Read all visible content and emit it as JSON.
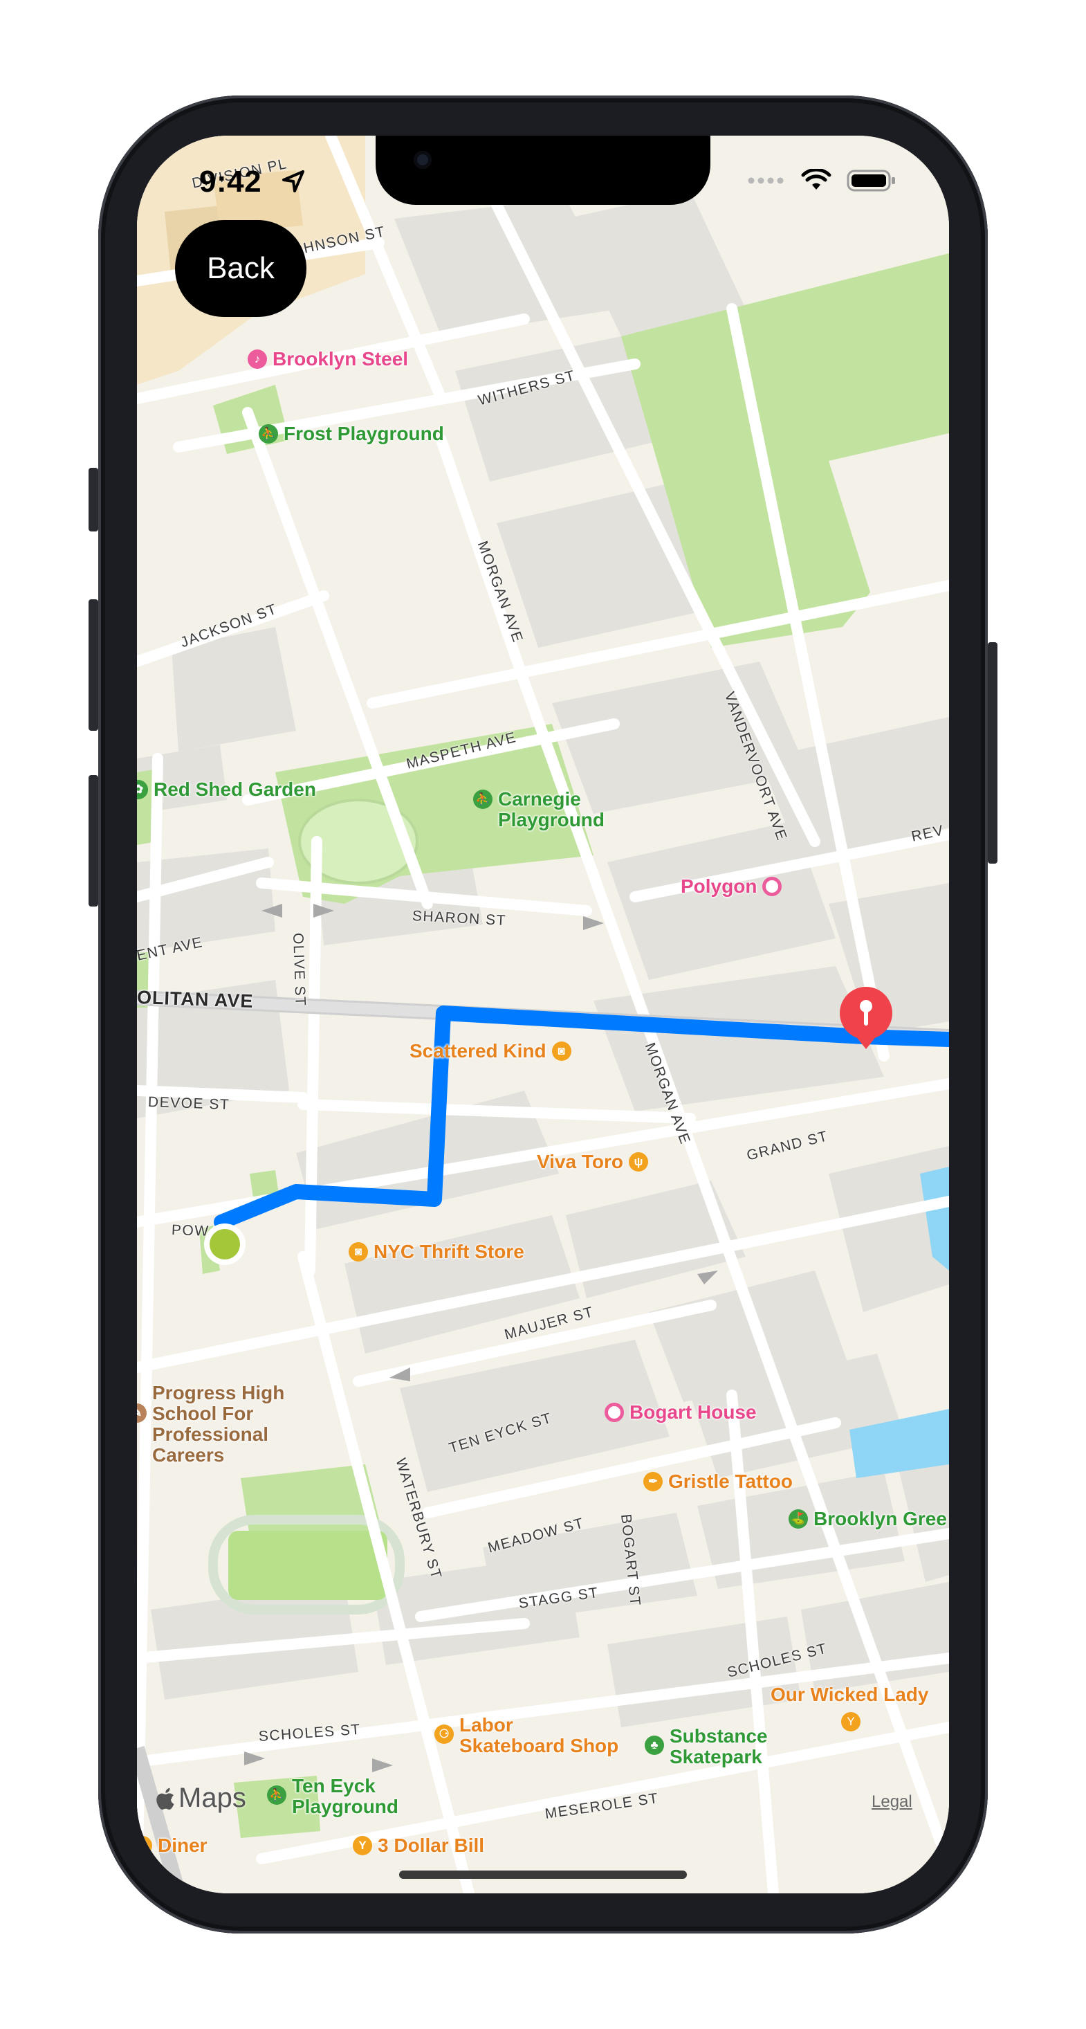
{
  "status_bar": {
    "time": "9:42"
  },
  "back_button": {
    "label": "Back"
  },
  "map": {
    "attribution": "Maps",
    "legal": "Legal",
    "route_color": "#007aff",
    "origin_color": "#a4c639",
    "destination_color": "#f0424a",
    "park_color": "#c2e39f",
    "water_color": "#8fd5f5",
    "pois": [
      {
        "label": "Brooklyn Steel",
        "category": "music-icon",
        "color": "pink"
      },
      {
        "label": "Frost Playground",
        "category": "playground-icon",
        "color": "green"
      },
      {
        "label": "Red Shed Garden",
        "category": "park-icon",
        "color": "green"
      },
      {
        "label": "Carnegie\nPlayground",
        "category": "playground-icon",
        "color": "green"
      },
      {
        "label": "Polygon",
        "category": "point-icon",
        "color": "pink"
      },
      {
        "label": "Scattered Kind",
        "category": "shopping-bag-icon",
        "color": "orange"
      },
      {
        "label": "Viva Toro",
        "category": "restaurant-icon",
        "color": "orange"
      },
      {
        "label": "NYC Thrift Store",
        "category": "shopping-bag-icon",
        "color": "orange"
      },
      {
        "label": "Progress High\nSchool For\nProfessional\nCareers",
        "category": "school-icon",
        "color": "brown"
      },
      {
        "label": "Bogart House",
        "category": "point-icon",
        "color": "pink"
      },
      {
        "label": "Gristle Tattoo",
        "category": "tattoo-icon",
        "color": "orange"
      },
      {
        "label": "Brooklyn Gree",
        "category": "park-icon",
        "color": "green"
      },
      {
        "label": "Our Wicked Lady",
        "category": "bar-icon",
        "color": "orange"
      },
      {
        "label": "Labor\nSkateboard Shop",
        "category": "skateboard-icon",
        "color": "orange"
      },
      {
        "label": "Substance\nSkatepark",
        "category": "tree-icon",
        "color": "green"
      },
      {
        "label": "Ten Eyck\nPlayground",
        "category": "playground-icon",
        "color": "green"
      },
      {
        "label": "3 Dollar Bill",
        "category": "bar-icon",
        "color": "orange"
      },
      {
        "label": "Diner",
        "category": "restaurant-icon",
        "color": "orange"
      }
    ],
    "streets": [
      "DIVISION PL",
      "JOHNSON ST",
      "WITHERS ST",
      "JACKSON ST",
      "MORGAN AVE",
      "MASPETH AVE",
      "VANDERVOORT AVE",
      "SHARON ST",
      "OLIVE ST",
      "ENT AVE",
      "OLITAN AVE",
      "DEVOE ST",
      "GRAND ST",
      "MORGAN AVE",
      "POW",
      "MAUJER ST",
      "TEN EYCK ST",
      "WATERBURY ST",
      "MEADOW ST",
      "BOGART ST",
      "STAGG ST",
      "SCHOLES ST",
      "SCHOLES ST",
      "MESEROLE ST",
      "REV"
    ]
  }
}
